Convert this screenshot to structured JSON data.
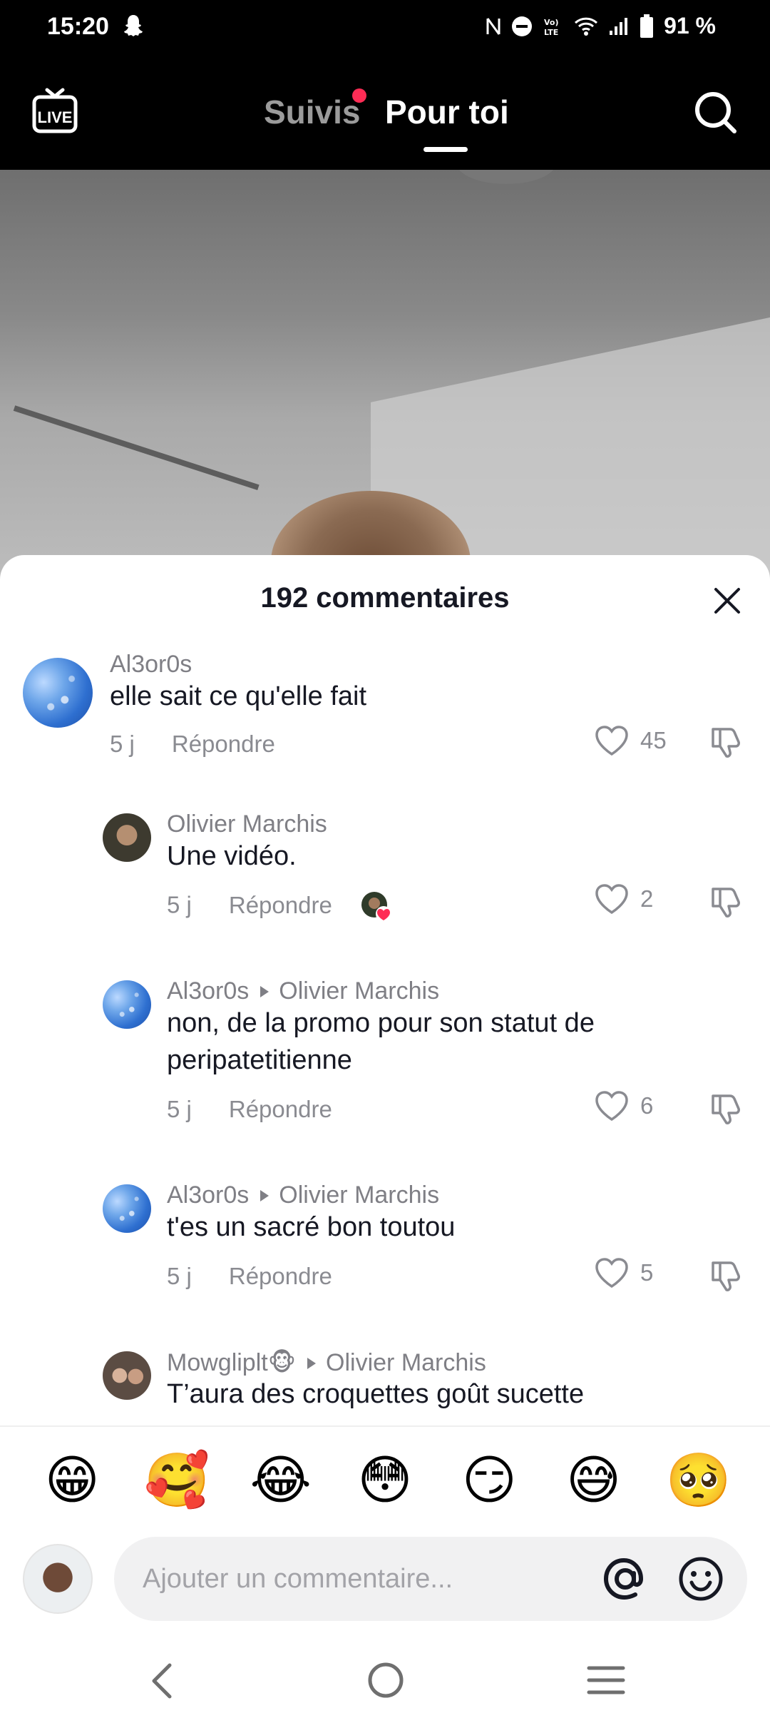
{
  "status_bar": {
    "time": "15:20",
    "battery": "91 %",
    "icons": [
      "snapchat-icon",
      "nfc-icon",
      "do-not-disturb-icon",
      "volte-icon",
      "wifi-icon",
      "signal-icon",
      "battery-icon"
    ]
  },
  "top_nav": {
    "live_label": "LIVE",
    "tabs": [
      {
        "label": "Suivis",
        "active": false,
        "has_dot": true
      },
      {
        "label": "Pour toi",
        "active": true
      }
    ]
  },
  "comments_sheet": {
    "title": "192 commentaires",
    "comments": [
      {
        "author": "Al3or0s",
        "reply_to": "",
        "text": "elle sait ce qu'elle fait",
        "age": "5 j",
        "reply_label": "Répondre",
        "likes": "45",
        "avatar": "sky"
      },
      {
        "author": "Olivier Marchis",
        "reply_to": "",
        "text": "Une vidéo.",
        "age": "5 j",
        "reply_label": "Répondre",
        "likes": "2",
        "avatar": "face",
        "creator_liked": true
      },
      {
        "author": "Al3or0s",
        "reply_to": "Olivier Marchis",
        "text": "non, de la promo pour son statut de peripatetitienne",
        "age": "5 j",
        "reply_label": "Répondre",
        "likes": "6",
        "avatar": "sky"
      },
      {
        "author": "Al3or0s",
        "reply_to": "Olivier Marchis",
        "text": "t'es un sacré bon toutou",
        "age": "5 j",
        "reply_label": "Répondre",
        "likes": "5",
        "avatar": "sky"
      },
      {
        "author": "Mowgliplt🐵",
        "reply_to": "Olivier Marchis",
        "text": "T’aura des croquettes goût sucette",
        "avatar": "couple"
      }
    ]
  },
  "emoji_bar": [
    "😁",
    "🥰",
    "😂",
    "😳",
    "😏",
    "😅",
    "🥺"
  ],
  "comment_input": {
    "placeholder": "Ajouter un commentaire..."
  },
  "colors": {
    "accent": "#fe2c55",
    "text_primary": "#161823",
    "text_secondary": "#8a8b91"
  }
}
